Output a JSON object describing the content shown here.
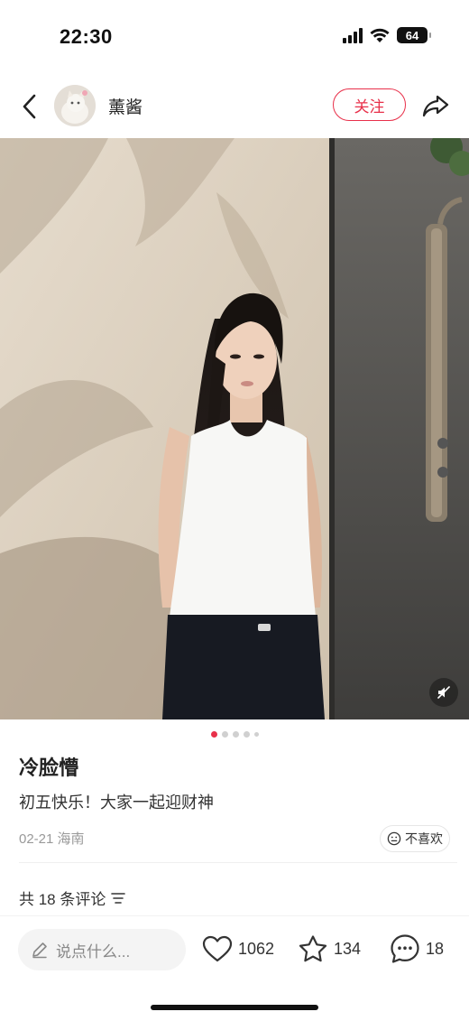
{
  "status_bar": {
    "time": "22:30",
    "battery": "64"
  },
  "author": {
    "name": "薰酱",
    "follow_label": "关注"
  },
  "photo": {
    "total_pages": 5,
    "current_page": 1
  },
  "post": {
    "title": "冷脸懵",
    "body": "初五快乐！大家一起迎财神",
    "meta": "02-21 海南",
    "dislike_label": "不喜欢"
  },
  "comments": {
    "count_label": "共 18 条评论"
  },
  "bottom_bar": {
    "input_placeholder": "说点什么...",
    "likes": "1062",
    "collects": "134",
    "comments": "18"
  },
  "colors": {
    "accent": "#e8304a"
  },
  "icons": [
    "back-icon",
    "share-icon",
    "mute-icon",
    "sort-icon",
    "neutral-face-icon",
    "pencil-icon",
    "heart-icon",
    "star-icon",
    "comment-bubble-icon"
  ]
}
